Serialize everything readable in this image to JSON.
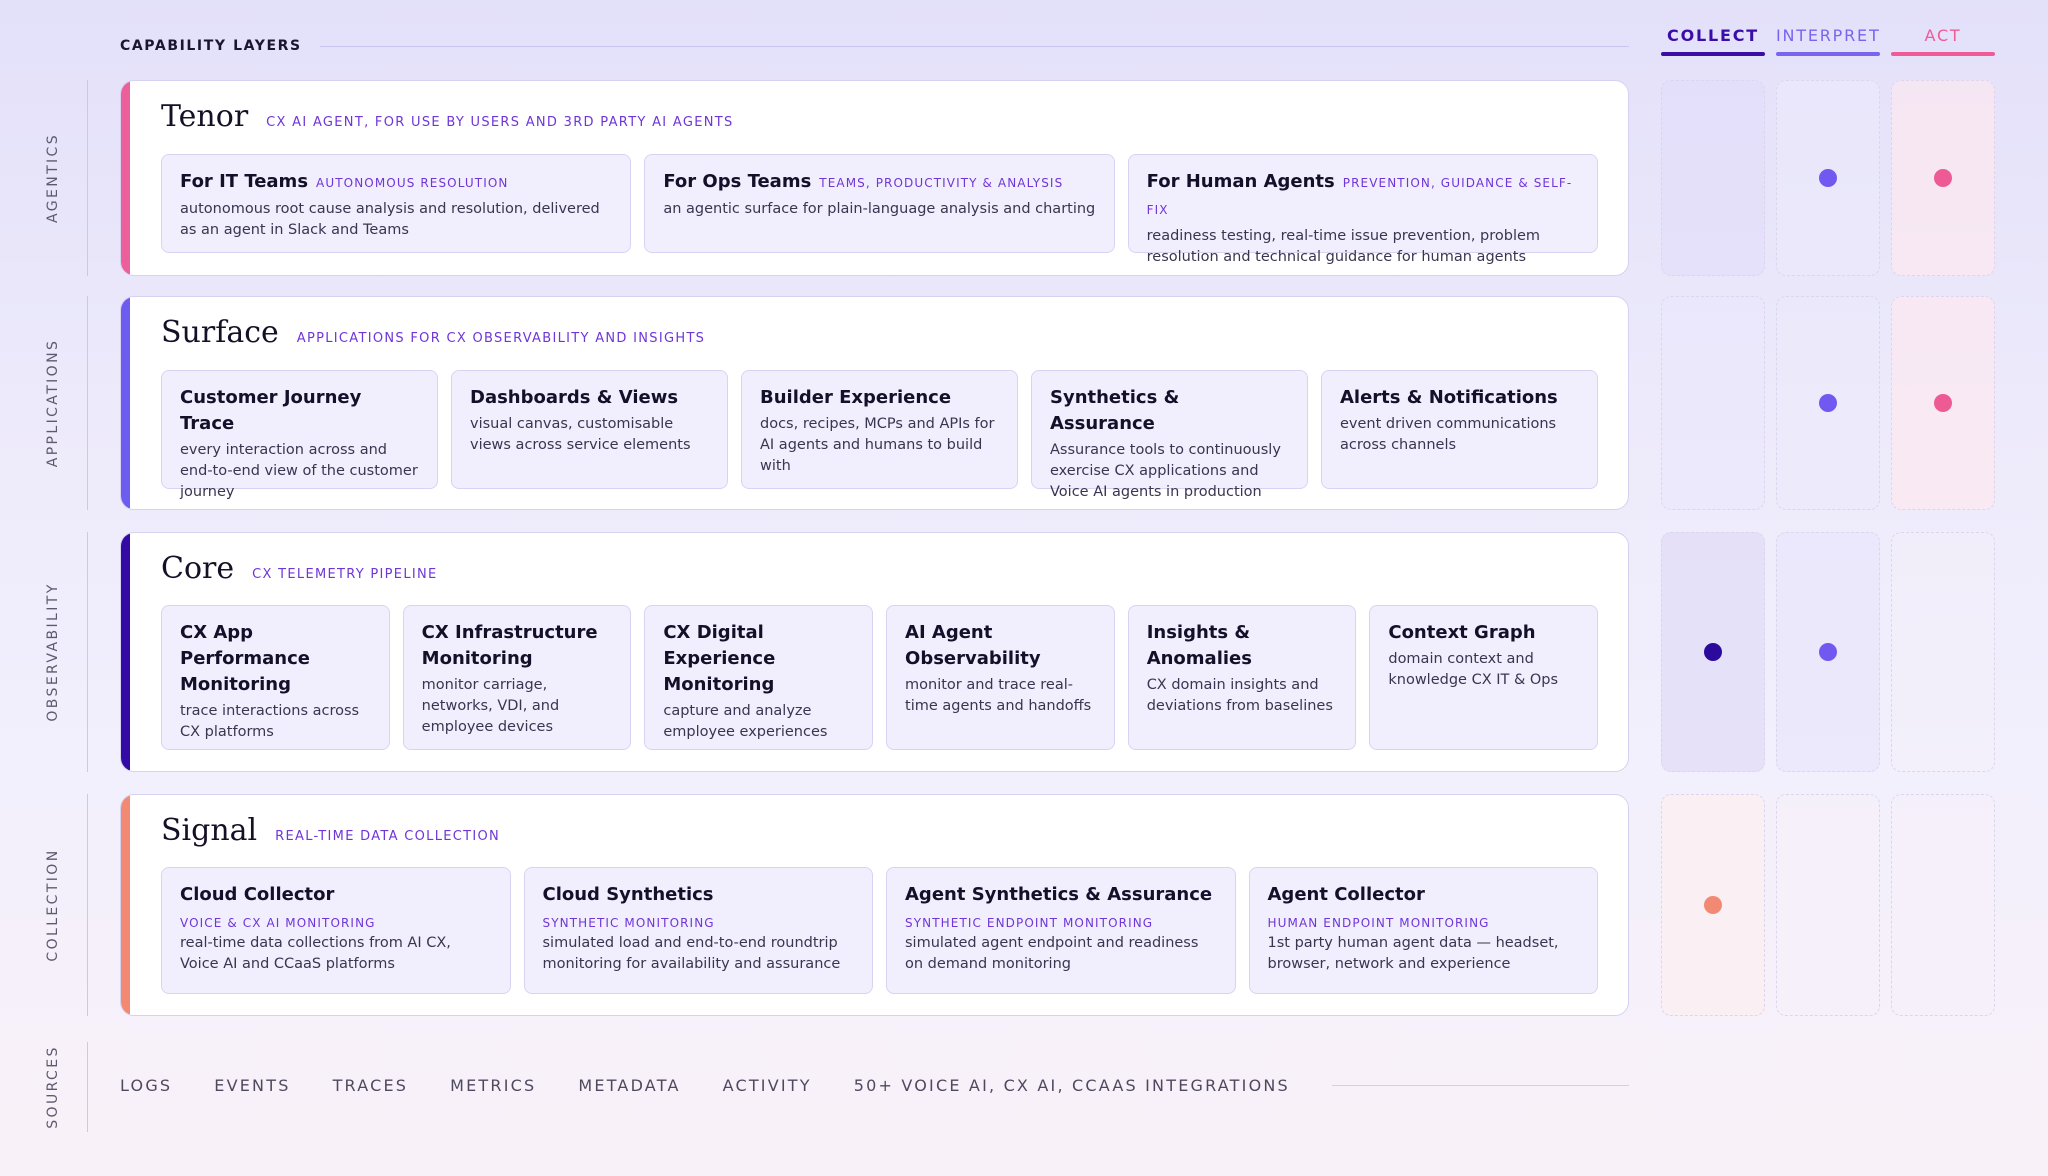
{
  "header": {
    "title": "CAPABILITY LAYERS"
  },
  "columns": [
    {
      "label": "COLLECT",
      "color": "#3a0ca8"
    },
    {
      "label": "INTERPRET",
      "color": "#7b63f0"
    },
    {
      "label": "ACT",
      "color": "#ef5a97"
    }
  ],
  "rails": [
    "AGENTICS",
    "APPLICATIONS",
    "OBSERVABILITY",
    "COLLECTION",
    "SOURCES"
  ],
  "layers": [
    {
      "title": "Tenor",
      "subtitle": "CX AI AGENT, FOR USE BY USERS AND 3RD PARTY AI AGENTS",
      "accent": "#ec5f9a",
      "cards": [
        {
          "title": "For IT Teams",
          "tag": "AUTONOMOUS RESOLUTION",
          "desc": "autonomous root cause analysis and resolution, delivered as an agent in Slack and Teams"
        },
        {
          "title": "For Ops Teams",
          "tag": "TEAMS, PRODUCTIVITY & ANALYSIS",
          "desc": "an agentic surface for plain-language analysis and charting"
        },
        {
          "title": "For Human Agents",
          "tag": "PREVENTION, GUIDANCE & SELF-FIX",
          "desc": "readiness testing, real-time issue prevention, problem resolution and technical guidance for human agents"
        }
      ]
    },
    {
      "title": "Surface",
      "subtitle": "APPLICATIONS FOR CX OBSERVABILITY AND INSIGHTS",
      "accent": "#6d5cf0",
      "cards": [
        {
          "title": "Customer Journey Trace",
          "desc": "every interaction across and end-to-end view of the customer journey"
        },
        {
          "title": "Dashboards & Views",
          "desc": "visual canvas, customisable views across service elements"
        },
        {
          "title": "Builder Experience",
          "desc": "docs, recipes, MCPs and APIs for AI agents and humans to build with"
        },
        {
          "title": "Synthetics & Assurance",
          "desc": "Assurance tools to continuously exercise CX applications and Voice AI agents in production"
        },
        {
          "title": "Alerts & Notifications",
          "desc": "event driven communications across channels"
        }
      ]
    },
    {
      "title": "Core",
      "subtitle": "CX TELEMETRY PIPELINE",
      "accent": "#330aa6",
      "cards": [
        {
          "title": "CX App Performance Monitoring",
          "desc": "trace interactions across CX platforms"
        },
        {
          "title": "CX Infrastructure Monitoring",
          "desc": "monitor carriage, networks, VDI, and employee devices"
        },
        {
          "title": "CX Digital Experience Monitoring",
          "desc": "capture and analyze employee experiences"
        },
        {
          "title": "AI Agent Observability",
          "desc": "monitor and trace real-time agents and handoffs"
        },
        {
          "title": "Insights & Anomalies",
          "desc": "CX domain insights and deviations from baselines"
        },
        {
          "title": "Context Graph",
          "desc": "domain context and knowledge CX IT & Ops"
        }
      ]
    },
    {
      "title": "Signal",
      "subtitle": "REAL-TIME DATA COLLECTION",
      "accent": "#f28a73",
      "cards": [
        {
          "title": "Cloud Collector",
          "tag": "VOICE & CX AI MONITORING",
          "desc": "real-time data collections from AI CX, Voice AI and CCaaS platforms"
        },
        {
          "title": "Cloud Synthetics",
          "tag": "SYNTHETIC MONITORING",
          "desc": "simulated load and end-to-end roundtrip monitoring for availability and assurance"
        },
        {
          "title": "Agent Synthetics & Assurance",
          "tag": "SYNTHETIC ENDPOINT MONITORING",
          "desc": "simulated agent endpoint and readiness on demand monitoring"
        },
        {
          "title": "Agent Collector",
          "tag": "HUMAN ENDPOINT MONITORING",
          "desc": "1st party human agent data — headset, browser, network and experience"
        }
      ]
    }
  ],
  "matrix": [
    {
      "layer": "Tenor",
      "collect": false,
      "interpret": true,
      "act": true
    },
    {
      "layer": "Surface",
      "collect": false,
      "interpret": true,
      "act": true
    },
    {
      "layer": "Core",
      "collect": true,
      "interpret": true,
      "act": false
    },
    {
      "layer": "Signal",
      "collect": true,
      "interpret": false,
      "act": false
    }
  ],
  "matrix_colors": {
    "collect_dot": "#2c0a9c",
    "collect_dot_signal": "#f28a73",
    "interpret_dot": "#7158f0",
    "act_dot": "#ee5a93"
  },
  "sources": [
    "LOGS",
    "EVENTS",
    "TRACES",
    "METRICS",
    "METADATA",
    "ACTIVITY",
    "50+ VOICE AI, CX AI, CCAAS INTEGRATIONS"
  ]
}
